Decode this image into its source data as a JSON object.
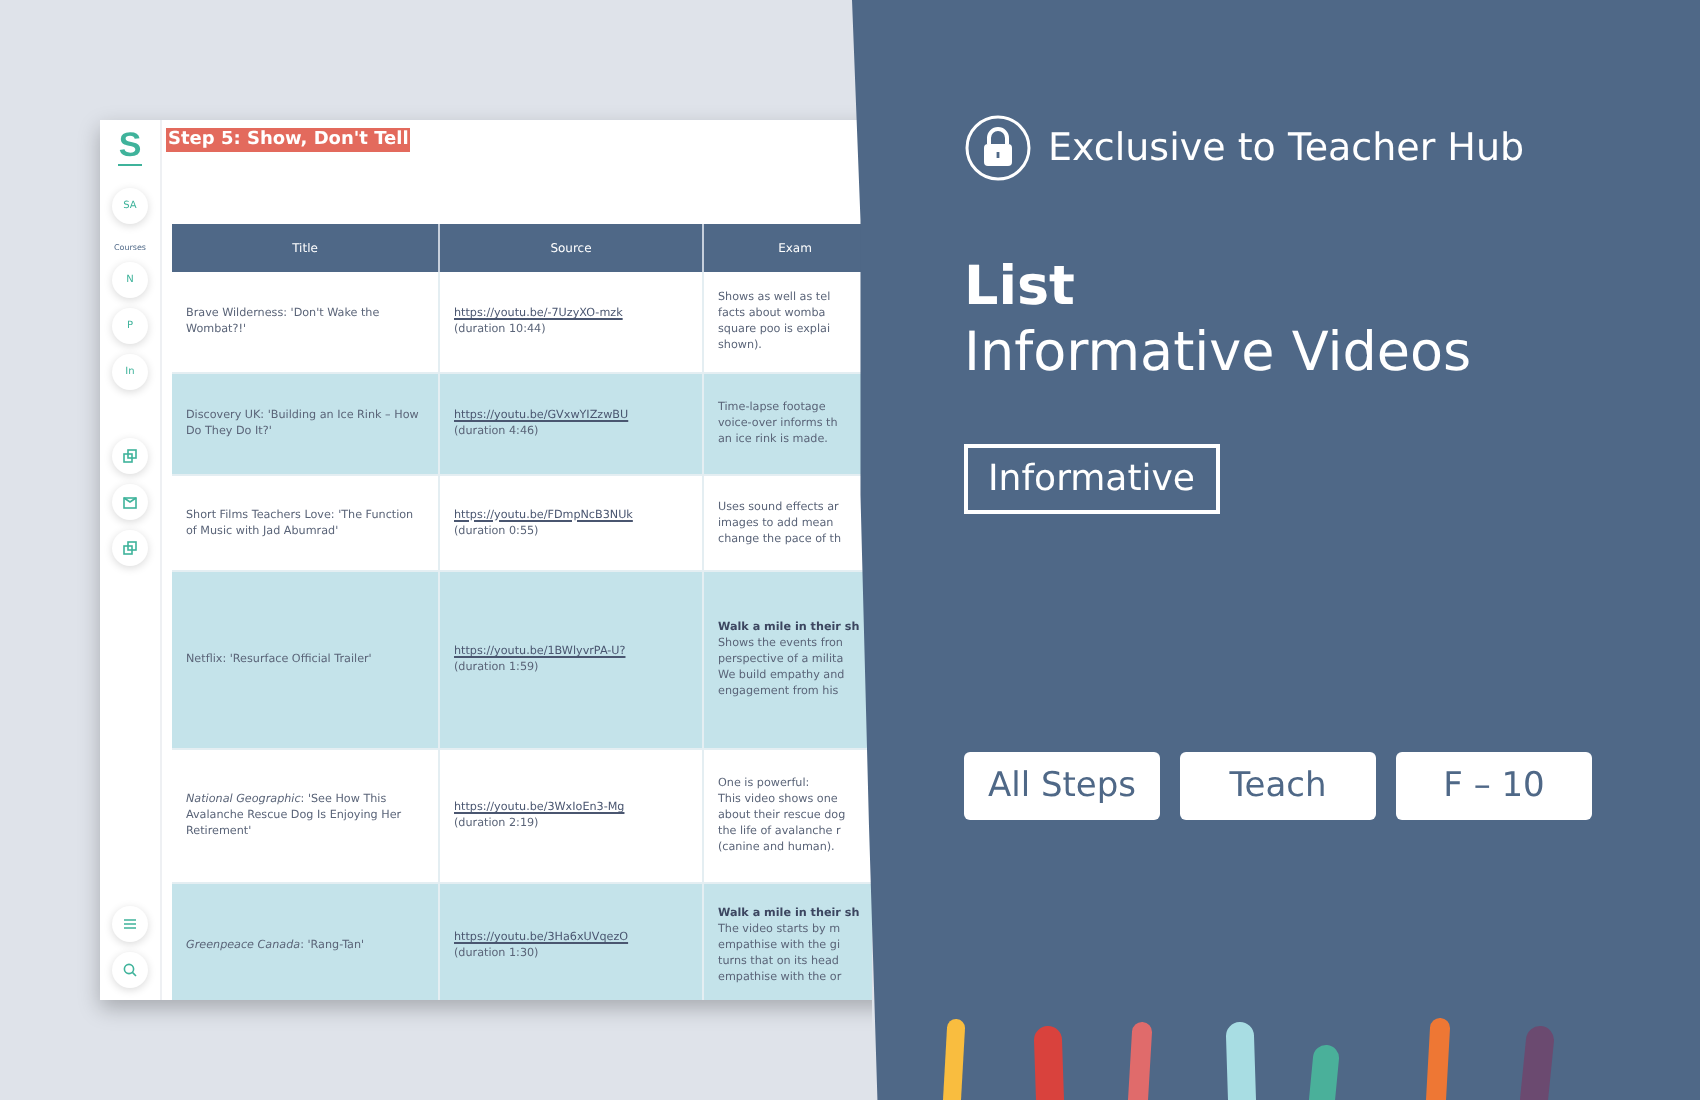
{
  "sidebar": {
    "logo": "S",
    "user": "SA",
    "courses_label": "Courses",
    "courses": [
      "N",
      "P",
      "In"
    ]
  },
  "document": {
    "heading": "Step 5: Show, Don't Tell",
    "table": {
      "columns": [
        "Title",
        "Source",
        "Exam"
      ],
      "rows": [
        {
          "title": "Brave Wilderness: 'Don't Wake the Wombat?!'",
          "link": "https://youtu.be/-7UzyXO-mzk",
          "duration": "(duration 10:44)",
          "example": [
            {
              "text": "Shows as well as tel",
              "bold": false
            },
            {
              "text": "facts about womba",
              "bold": false
            },
            {
              "text": "square poo is explai",
              "bold": false
            },
            {
              "text": "shown).",
              "bold": false
            }
          ]
        },
        {
          "title": "Discovery UK: 'Building an Ice Rink – How Do They Do It?'",
          "link": "https://youtu.be/GVxwYIZzwBU",
          "duration": "(duration 4:46)",
          "example": [
            {
              "text": "Time-lapse footage",
              "bold": false
            },
            {
              "text": "voice-over informs th",
              "bold": false
            },
            {
              "text": "an ice rink is made.",
              "bold": false
            }
          ]
        },
        {
          "title": "Short Films Teachers Love: 'The Function of Music with Jad Abumrad'",
          "link": "https://youtu.be/FDmpNcB3NUk",
          "duration": "(duration 0:55)",
          "example": [
            {
              "text": "Uses sound effects ar",
              "bold": false
            },
            {
              "text": "images to add mean",
              "bold": false
            },
            {
              "text": "change the pace of th",
              "bold": false
            }
          ]
        },
        {
          "title": "Netflix: 'Resurface Official Trailer'",
          "link": "https://youtu.be/1BWlyvrPA-U?",
          "duration": "(duration 1:59)",
          "example": [
            {
              "text": "Walk a mile in their sh",
              "bold": true
            },
            {
              "text": "Shows the events fron",
              "bold": false
            },
            {
              "text": "perspective of a milita",
              "bold": false
            },
            {
              "text": "We build empathy and",
              "bold": false
            },
            {
              "text": "engagement from his",
              "bold": false
            }
          ]
        },
        {
          "title": "*National Geographic*: 'See How This Avalanche Rescue Dog Is Enjoying Her Retirement'",
          "link": "https://youtu.be/3WxIoEn3-Mg",
          "duration": "(duration 2:19)",
          "example": [
            {
              "text": "One is powerful:",
              "bold": false
            },
            {
              "text": "This video shows one",
              "bold": false
            },
            {
              "text": "about their rescue dog",
              "bold": false
            },
            {
              "text": "the life of avalanche r",
              "bold": false
            },
            {
              "text": "(canine and human).",
              "bold": false
            }
          ]
        },
        {
          "title": "*Greenpeace Canada*: 'Rang-Tan'",
          "link": "https://youtu.be/3Ha6xUVqezO",
          "duration": "(duration 1:30)",
          "example": [
            {
              "text": "Walk a mile in their sh",
              "bold": true
            },
            {
              "text": "The video starts by m",
              "bold": false
            },
            {
              "text": "empathise with the gi",
              "bold": false
            },
            {
              "text": "turns that on its head",
              "bold": false
            },
            {
              "text": "empathise with the or",
              "bold": false
            }
          ]
        }
      ]
    }
  },
  "promo": {
    "badge": "Exclusive to Teacher Hub",
    "title_bold": "List",
    "title": "Informative Videos",
    "category": "Informative",
    "tags": [
      "All Steps",
      "Teach",
      "F – 10"
    ]
  }
}
